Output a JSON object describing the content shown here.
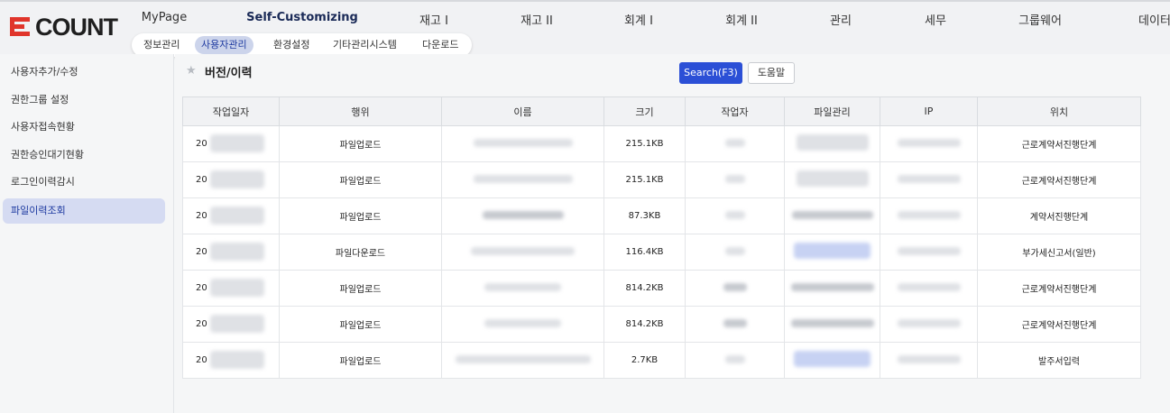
{
  "brand": {
    "name": "ECOUNT",
    "e_color": "#e0352b"
  },
  "main_nav": [
    {
      "label": "MyPage",
      "active": false
    },
    {
      "label": "Self-Customizing",
      "active": true
    },
    {
      "label": "재고 I",
      "active": false
    },
    {
      "label": "재고 II",
      "active": false
    },
    {
      "label": "회계 I",
      "active": false
    },
    {
      "label": "회계 II",
      "active": false
    },
    {
      "label": "관리",
      "active": false
    },
    {
      "label": "세무",
      "active": false
    },
    {
      "label": "그룹웨어",
      "active": false
    },
    {
      "label": "데이터",
      "active": false
    }
  ],
  "sub_nav": [
    {
      "label": "정보관리",
      "active": false
    },
    {
      "label": "사용자관리",
      "active": true
    },
    {
      "label": "환경설정",
      "active": false
    },
    {
      "label": "기타관리시스템",
      "active": false
    },
    {
      "label": "다운로드",
      "active": false
    }
  ],
  "sidebar": {
    "items": [
      {
        "label": "사용자추가/수정",
        "active": false
      },
      {
        "label": "권한그룹 설정",
        "active": false
      },
      {
        "label": "사용자접속현황",
        "active": false
      },
      {
        "label": "권한승인대기현황",
        "active": false
      },
      {
        "label": "로그인이력감시",
        "active": false
      },
      {
        "label": "파일이력조회",
        "active": true
      }
    ]
  },
  "page": {
    "title": "버전/이력",
    "star_icon": "star-icon",
    "search_button": "Search(F3)",
    "help_button": "도움말",
    "accent_color": "#2b4fd6"
  },
  "table": {
    "headers": [
      "작업일자",
      "행위",
      "이름",
      "크기",
      "작업자",
      "파일관리",
      "IP",
      "위치"
    ],
    "rows": [
      {
        "date_prefix": "20",
        "action": "파일업로드",
        "size": "215.1KB",
        "location": "근로계약서진행단계"
      },
      {
        "date_prefix": "20",
        "action": "파일업로드",
        "size": "215.1KB",
        "location": "근로계약서진행단계"
      },
      {
        "date_prefix": "20",
        "action": "파일업로드",
        "size": "87.3KB",
        "location": "계약서진행단계"
      },
      {
        "date_prefix": "20",
        "action": "파일다운로드",
        "size": "116.4KB",
        "location": "부가세신고서(일반)"
      },
      {
        "date_prefix": "20",
        "action": "파일업로드",
        "size": "814.2KB",
        "location": "근로계약서진행단계"
      },
      {
        "date_prefix": "20",
        "action": "파일업로드",
        "size": "814.2KB",
        "location": "근로계약서진행단계"
      },
      {
        "date_prefix": "20",
        "action": "파일업로드",
        "size": "2.7KB",
        "location": "발주서입력"
      }
    ]
  }
}
